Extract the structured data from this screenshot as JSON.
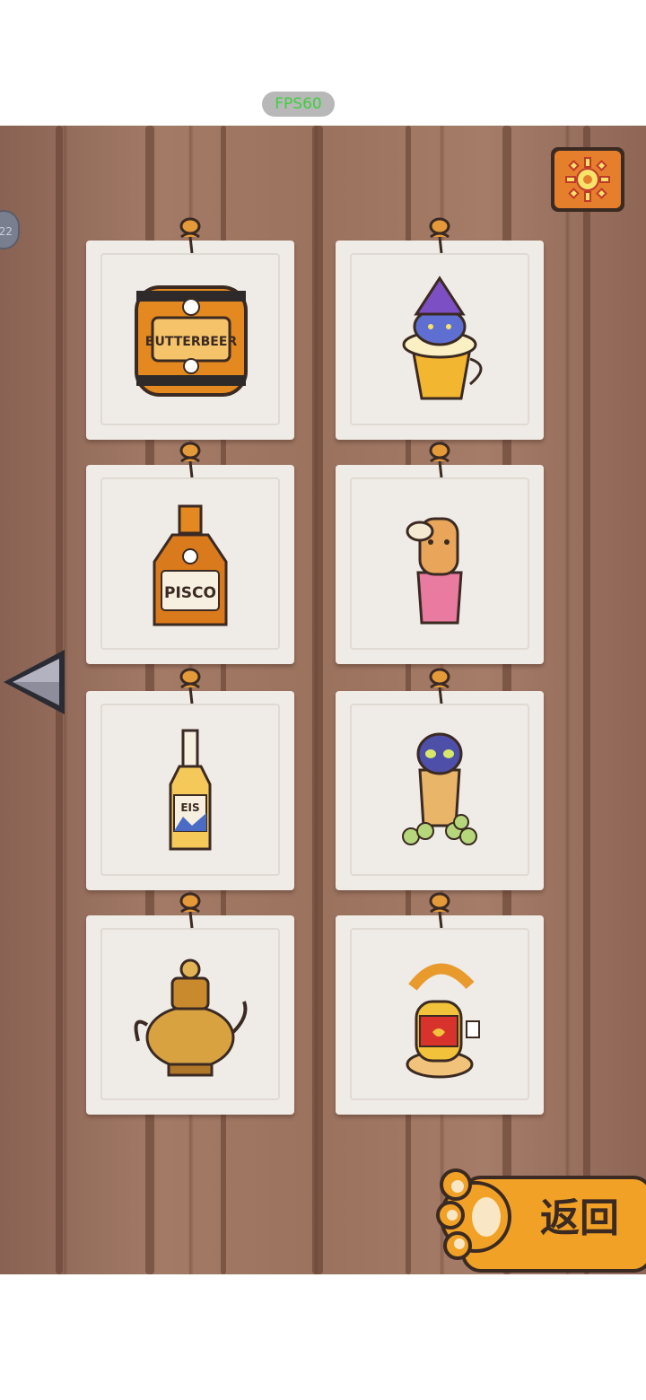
{
  "status": {
    "fps": "FPS60"
  },
  "side_badge": {
    "text": "22"
  },
  "cards": [
    {
      "name": "butterbeer-barrel",
      "label": "BUTTERBEER"
    },
    {
      "name": "wizard-cat-mug",
      "label": ""
    },
    {
      "name": "pisco-bottle",
      "label": "PISCO"
    },
    {
      "name": "llama-cat-glass",
      "label": ""
    },
    {
      "name": "eis-bottle",
      "label": "EIS"
    },
    {
      "name": "grape-cat-glass",
      "label": ""
    },
    {
      "name": "golden-teapot",
      "label": ""
    },
    {
      "name": "croissant-cat-drink",
      "label": ""
    }
  ],
  "back_button": {
    "label": "返回"
  },
  "colors": {
    "wood": "#9a725e",
    "card": "#efebe6",
    "paw": "#f0a126",
    "gear_bg": "#e57f2c",
    "pin": "#e59a3a"
  }
}
